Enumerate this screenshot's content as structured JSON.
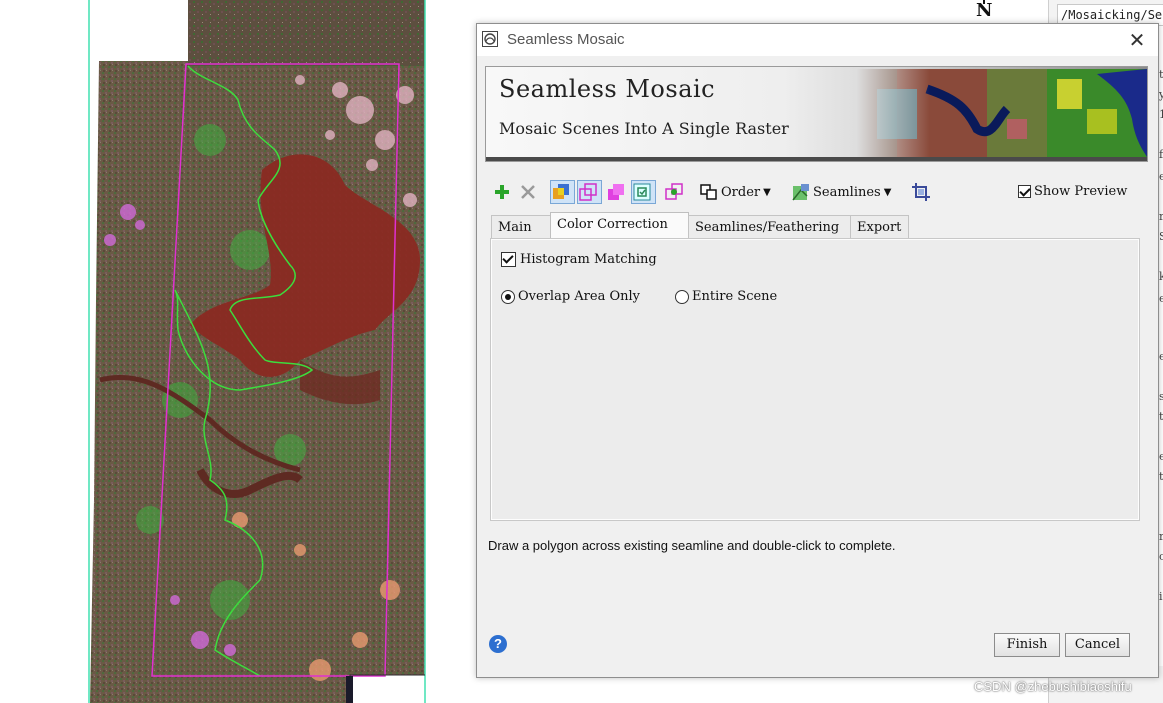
{
  "map": {
    "north_label": "N",
    "path_text": "/Mosaicking/Se",
    "edge_letters": [
      "t",
      "y",
      "1",
      "f",
      "e",
      "r",
      "S",
      "k",
      "e",
      "e",
      "s",
      "t",
      "e",
      "t",
      "r",
      "c",
      "i"
    ]
  },
  "dialog": {
    "title": "Seamless Mosaic",
    "close_glyph": "✕",
    "banner": {
      "title": "Seamless Mosaic",
      "subtitle": "Mosaic Scenes Into A Single Raster"
    },
    "toolbar": {
      "order_label": "Order",
      "seamlines_label": "Seamlines",
      "show_preview_label": "Show Preview",
      "show_preview_checked": true,
      "icons": [
        "add-icon",
        "remove-icon",
        "footprint-icon",
        "overlap-icon",
        "select-icon",
        "data-ignore-icon",
        "seamline-edit-icon",
        "order-icon",
        "seamlines-icon",
        "crop-icon"
      ]
    },
    "tabs": [
      {
        "label": "Main",
        "active": false
      },
      {
        "label": "Color Correction",
        "active": true
      },
      {
        "label": "Seamlines/Feathering",
        "active": false
      },
      {
        "label": "Export",
        "active": false
      }
    ],
    "color_correction": {
      "histogram_label": "Histogram Matching",
      "histogram_checked": true,
      "options": [
        {
          "label": "Overlap Area Only",
          "selected": true
        },
        {
          "label": "Entire Scene",
          "selected": false
        }
      ]
    },
    "status_text": "Draw a polygon across existing seamline and double-click to complete.",
    "help_glyph": "?",
    "buttons": {
      "finish": "Finish",
      "cancel": "Cancel"
    }
  },
  "watermark": "CSDN @zhebushibiaoshifu",
  "colors": {
    "seamline": "#3ddc3d",
    "footprint": "#e030d0",
    "selection": "#40e0b0",
    "water": "#8a2a22"
  }
}
